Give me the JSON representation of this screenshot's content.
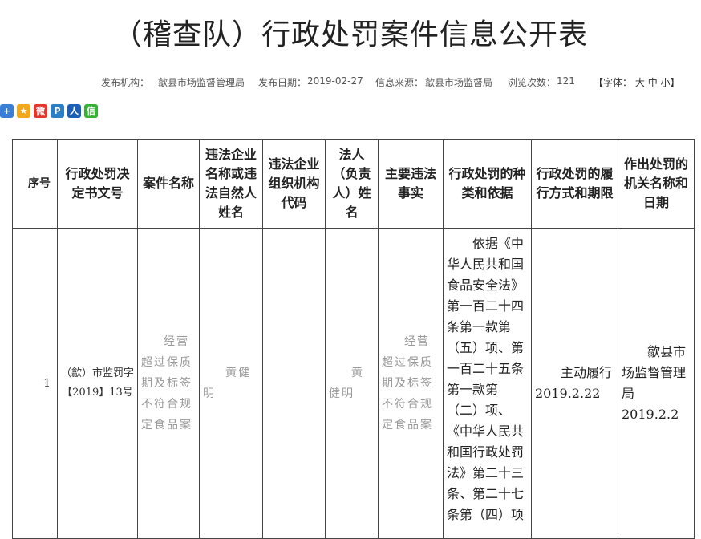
{
  "page": {
    "title": "（稽查队）行政处罚案件信息公开表"
  },
  "meta": {
    "publisher_label": "发布机构：",
    "publisher": "歙县市场监督管理局",
    "date_label": "发布日期：",
    "date": "2019-02-27",
    "source_label": "信息来源：",
    "source": "歙县市场监督局",
    "views_label": "浏览次数：",
    "views": "121",
    "font_label": "【字体：",
    "font_large": "大",
    "font_medium": "中",
    "font_small": "小",
    "font_close": "】"
  },
  "share": {
    "icons": [
      {
        "name": "share-plus-icon",
        "glyph": "+",
        "color": "#3a7fd5"
      },
      {
        "name": "qzone-icon",
        "glyph": "★",
        "color": "#f2a81c"
      },
      {
        "name": "weibo-icon",
        "glyph": "微",
        "color": "#e6352b"
      },
      {
        "name": "tencent-weibo-icon",
        "glyph": "P",
        "color": "#2b7fc7"
      },
      {
        "name": "renren-icon",
        "glyph": "人",
        "color": "#1c5fb8"
      },
      {
        "name": "wechat-icon",
        "glyph": "信",
        "color": "#35b233"
      }
    ]
  },
  "table": {
    "headers": [
      "序号",
      "行政处罚决定书文号",
      "案件名称",
      "违法企业名称或违法自然人姓名",
      "违法企业组织机构代码",
      "法人（负责人）姓名",
      "主要违法事实",
      "行政处罚的种类和依据",
      "行政处罚的履行方式和期限",
      "作出处罚的机关名称和日期"
    ],
    "rows": [
      {
        "number": "1",
        "decision_no": "（歙）市监罚字【2019】13号",
        "case_name": "经营超过保质期及标签不符合规定食品案",
        "violator": "黄健明",
        "org_code": "",
        "legal_person": "黄健明",
        "facts": "经营超过保质期及标签不符合规定食品案",
        "basis": "依据《中华人民共和国食品安全法》第一百二十四条第一款第（五）项、第一百二十五条第一款第（二）项、《中华人民共和国行政处罚法》第二十三条、第二十七条第（四）项",
        "method": "主动履行2019.2.22",
        "authority": "歙县市场监督管理局2019.2.2"
      }
    ]
  }
}
